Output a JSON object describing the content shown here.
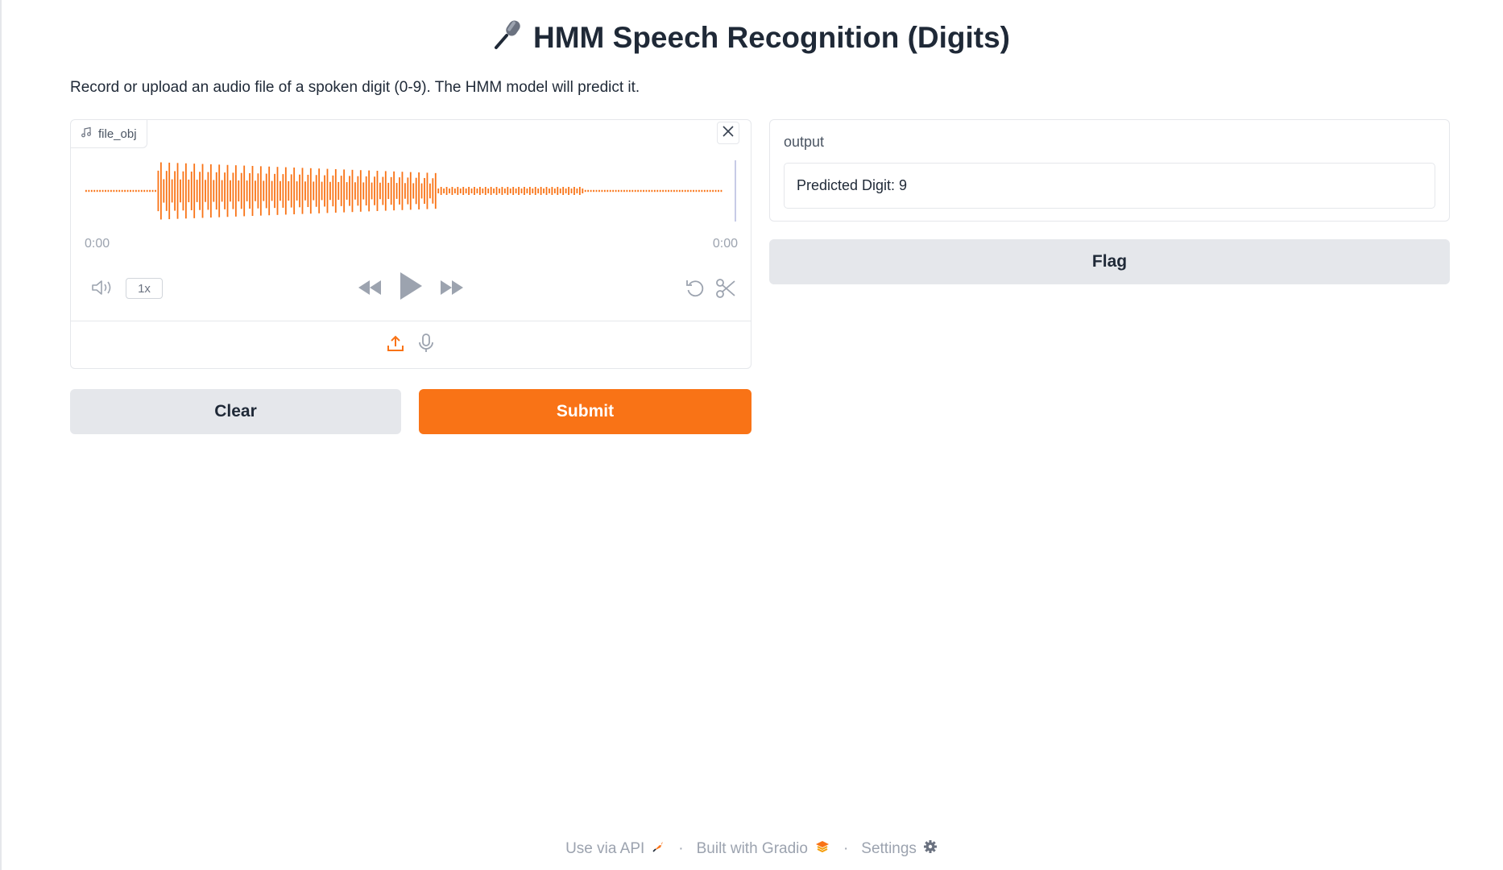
{
  "header": {
    "title": "HMM Speech Recognition (Digits)",
    "title_icon": "microphone-emoji"
  },
  "description": "Record or upload an audio file of a spoken digit (0-9). The HMM model will predict it.",
  "audio": {
    "label": "file_obj",
    "current_time": "0:00",
    "duration": "0:00",
    "speed": "1x",
    "accent_color": "#f97316"
  },
  "buttons": {
    "clear": "Clear",
    "submit": "Submit",
    "flag": "Flag"
  },
  "output": {
    "label": "output",
    "value": "Predicted Digit: 9"
  },
  "footer": {
    "api": "Use via API",
    "built": "Built with Gradio",
    "settings": "Settings",
    "separator": "·"
  }
}
